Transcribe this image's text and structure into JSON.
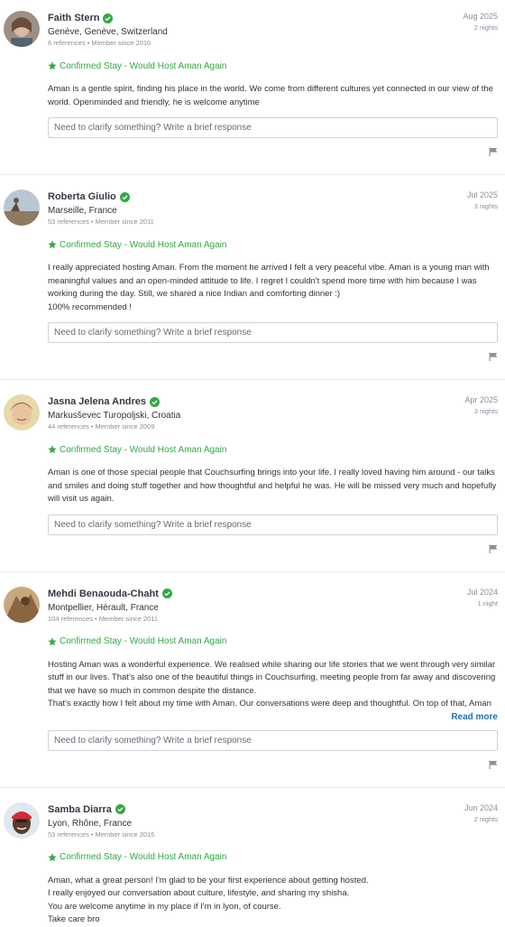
{
  "colors": {
    "accent_green": "#33a845",
    "link_blue": "#1f6fb5",
    "name": "#333a44",
    "muted": "#8a8f99"
  },
  "reply_placeholder": "Need to clarify something? Write a brief response",
  "read_more_label": "Read more",
  "icons": {
    "verified": "verified-check-icon",
    "confirmed": "star-icon",
    "report": "flag-icon"
  },
  "references": [
    {
      "name": "Faith Stern",
      "location": "Genève, Genève, Switzerland",
      "refs": "6 references",
      "member_since": "Member since 2010",
      "date": "Aug 2025",
      "nights": "2 nights",
      "confirmed": "Confirmed Stay - Would Host Aman Again",
      "body": [
        "Aman is a gentle spirit, finding his place in the world. We come from different cultures yet connected in our view of the world. Openminded and friendly, he is welcome anytime"
      ]
    },
    {
      "name": "Roberta Giulio",
      "location": "Marseille, France",
      "refs": "53 references",
      "member_since": "Member since 2011",
      "date": "Jul 2025",
      "nights": "3 nights",
      "confirmed": "Confirmed Stay - Would Host Aman Again",
      "body": [
        "I really appreciated hosting Aman. From the moment he arrived I felt a very peaceful vibe. Aman is a young man with meaningful values and an open-minded attitude to life. I regret I couldn't spend more time with him because I was working during the day. Still, we shared a nice Indian and comforting dinner :)",
        "100% recommended !"
      ]
    },
    {
      "name": "Jasna Jelena Andres",
      "location": "Markusševec Turopoljski, Croatia",
      "refs": "44 references",
      "member_since": "Member since 2009",
      "date": "Apr 2025",
      "nights": "3 nights",
      "confirmed": "Confirmed Stay - Would Host Aman Again",
      "body": [
        "Aman is one of those special people that Couchsurfing brings into your life. I really loved having him around - our talks and smiles and doing stuff together and how thoughtful and helpful he was. He will be missed very much and hopefully will visit us again."
      ]
    },
    {
      "name": "Mehdi Benaouda-Chaht",
      "location": "Montpellier, Hérault, France",
      "refs": "104 references",
      "member_since": "Member since 2011",
      "date": "Jul 2024",
      "nights": "1 night",
      "confirmed": "Confirmed Stay - Would Host Aman Again",
      "body": [
        "Hosting Aman was a wonderful experience. We realised while sharing our life stories that we went through very similar stuff in our lives. That's also one of the beautiful things in Couchsurfing, meeting people from far away and discovering that we have so much in common despite the distance.",
        "That's exactly how I felt about my time with Aman. Our conversations were deep and thoughtful. On top of that, Aman"
      ]
    },
    {
      "name": "Samba Diarra",
      "location": "Lyon, Rhône, France",
      "refs": "53 references",
      "member_since": "Member since 2015",
      "date": "Jun 2024",
      "nights": "2 nights",
      "confirmed": "Confirmed Stay - Would Host Aman Again",
      "body": [
        "Aman, what a great person! I'm glad to be your first experience about getting hosted.",
        "I really enjoyed our conversation about culture, lifestyle, and sharing my shisha.",
        "You are welcome anytime in my place if I'm in lyon, of course.",
        "Take care bro"
      ]
    }
  ]
}
